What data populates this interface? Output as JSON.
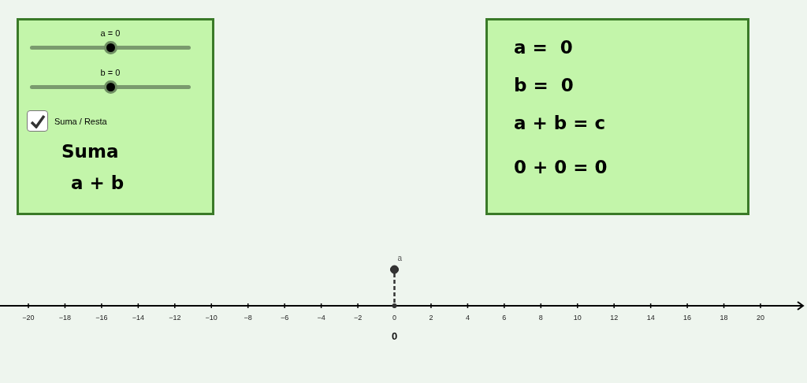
{
  "sliders": [
    {
      "label": "a = 0",
      "level": 0.5
    },
    {
      "label": "b = 0",
      "level": 0.5
    }
  ],
  "checkbox": {
    "label": "Suma / Resta",
    "checked": true
  },
  "operation_title": "Suma",
  "operation_expression": "a + b",
  "results": [
    "a =  0",
    "b =  0",
    "a + b = c",
    "0 + 0 = 0"
  ],
  "number_line": {
    "ticks": [
      "−20",
      "−18",
      "−16",
      "−14",
      "−12",
      "−10",
      "−8",
      "−6",
      "−4",
      "−2",
      "0",
      "2",
      "4",
      "6",
      "8",
      "10",
      "12",
      "14",
      "16",
      "18",
      "20"
    ],
    "point_label": "a",
    "value_label": "0"
  }
}
